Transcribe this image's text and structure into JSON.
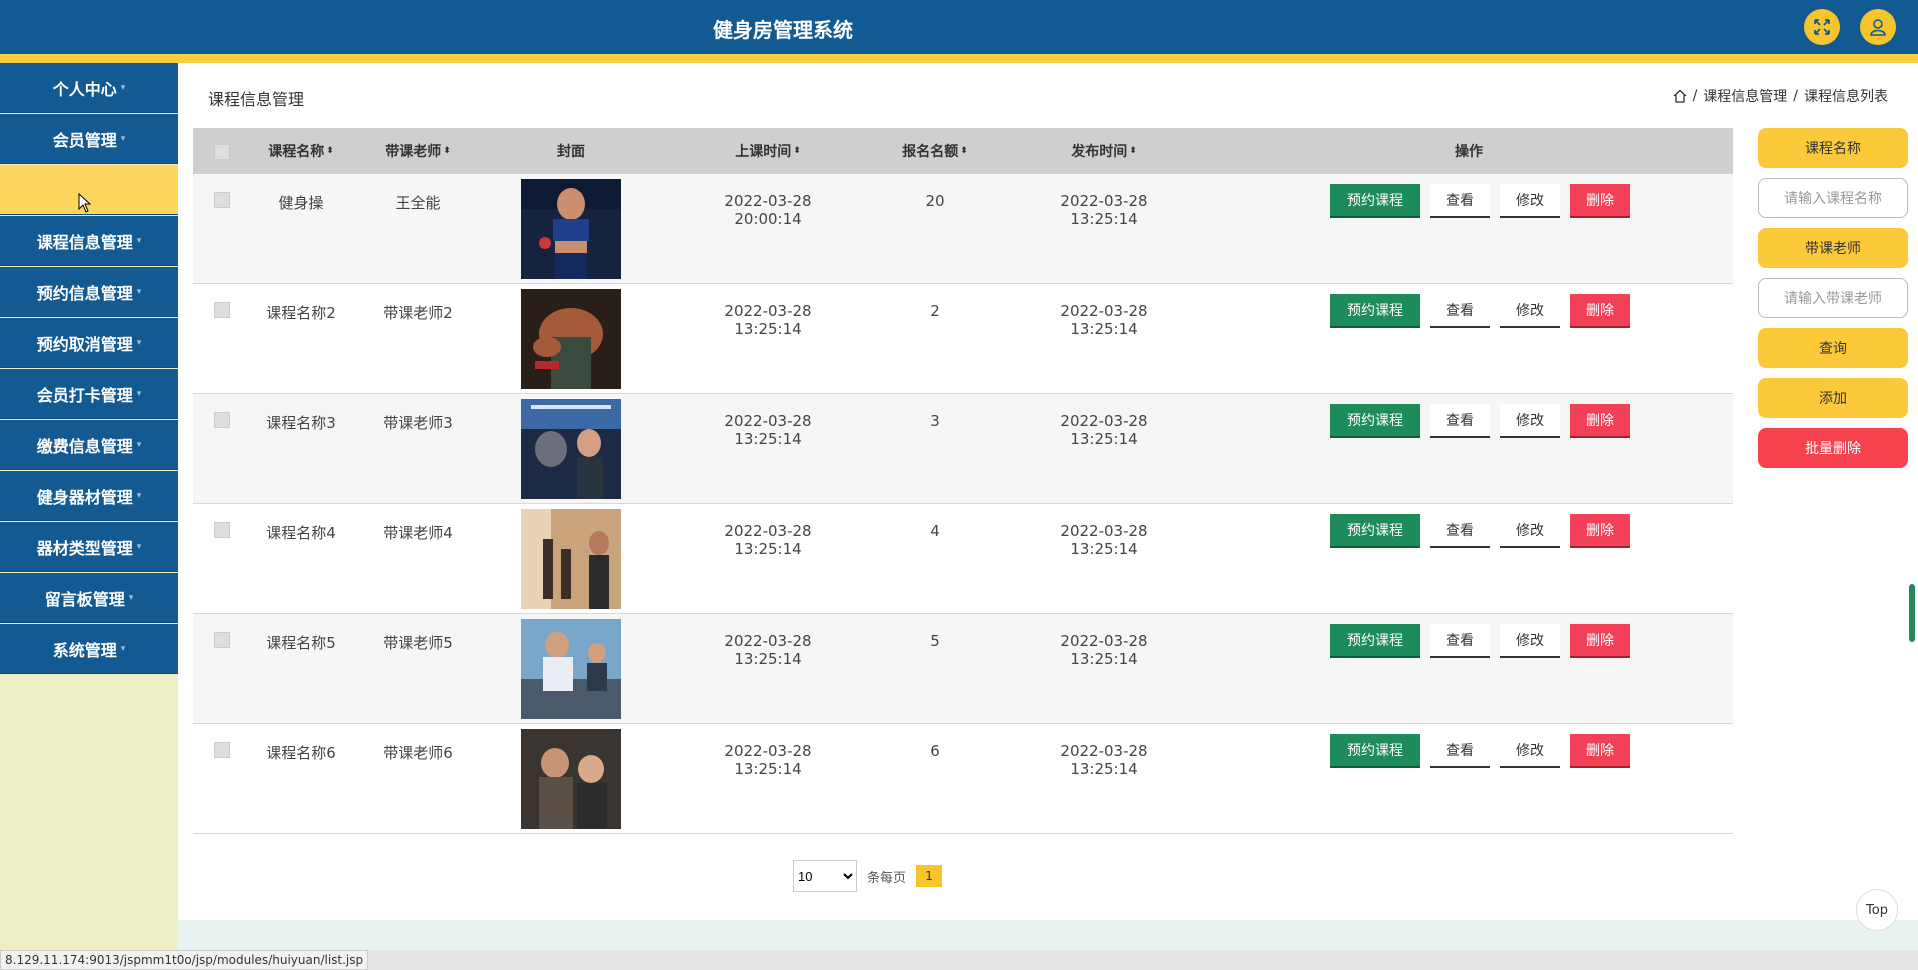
{
  "header": {
    "title": "健身房管理系统",
    "fullscreen_icon": "fullscreen-icon",
    "user_icon": "user-icon"
  },
  "sidebar": {
    "items": [
      {
        "label": "个人中心"
      },
      {
        "label": "会员管理"
      },
      {
        "label": ""
      },
      {
        "label": "课程信息管理"
      },
      {
        "label": "预约信息管理"
      },
      {
        "label": "预约取消管理"
      },
      {
        "label": "会员打卡管理"
      },
      {
        "label": "缴费信息管理"
      },
      {
        "label": "健身器材管理"
      },
      {
        "label": "器材类型管理"
      },
      {
        "label": "留言板管理"
      },
      {
        "label": "系统管理"
      }
    ]
  },
  "page": {
    "title": "课程信息管理",
    "breadcrumb": [
      "课程信息管理",
      "课程信息列表"
    ]
  },
  "table": {
    "headers": [
      "课程名称",
      "带课老师",
      "封面",
      "上课时间",
      "报名名额",
      "发布时间",
      "操作"
    ],
    "rows": [
      {
        "name": "健身操",
        "teacher": "王全能",
        "class_time": "2022-03-28 20:00:14",
        "quota": "20",
        "publish_time": "2022-03-28 13:25:14"
      },
      {
        "name": "课程名称2",
        "teacher": "带课老师2",
        "class_time": "2022-03-28 13:25:14",
        "quota": "2",
        "publish_time": "2022-03-28 13:25:14"
      },
      {
        "name": "课程名称3",
        "teacher": "带课老师3",
        "class_time": "2022-03-28 13:25:14",
        "quota": "3",
        "publish_time": "2022-03-28 13:25:14"
      },
      {
        "name": "课程名称4",
        "teacher": "带课老师4",
        "class_time": "2022-03-28 13:25:14",
        "quota": "4",
        "publish_time": "2022-03-28 13:25:14"
      },
      {
        "name": "课程名称5",
        "teacher": "带课老师5",
        "class_time": "2022-03-28 13:25:14",
        "quota": "5",
        "publish_time": "2022-03-28 13:25:14"
      },
      {
        "name": "课程名称6",
        "teacher": "带课老师6",
        "class_time": "2022-03-28 13:25:14",
        "quota": "6",
        "publish_time": "2022-03-28 13:25:14"
      }
    ],
    "actions": {
      "book": "预约课程",
      "view": "查看",
      "edit": "修改",
      "delete": "删除"
    }
  },
  "pagination": {
    "page_size": "10",
    "per_page_label": "条每页",
    "current_page": "1"
  },
  "search": {
    "course_label": "课程名称",
    "course_placeholder": "请输入课程名称",
    "teacher_label": "带课老师",
    "teacher_placeholder": "请输入带课老师",
    "query": "查询",
    "add": "添加",
    "batch_delete": "批量删除"
  },
  "misc": {
    "top": "Top",
    "status_url": "8.129.11.174:9013/jspmm1t0o/jsp/modules/huiyuan/list.jsp"
  },
  "colors": {
    "primary": "#135a93",
    "accent": "#f7cf3e",
    "green": "#1e8c5a",
    "red": "#f24156"
  }
}
